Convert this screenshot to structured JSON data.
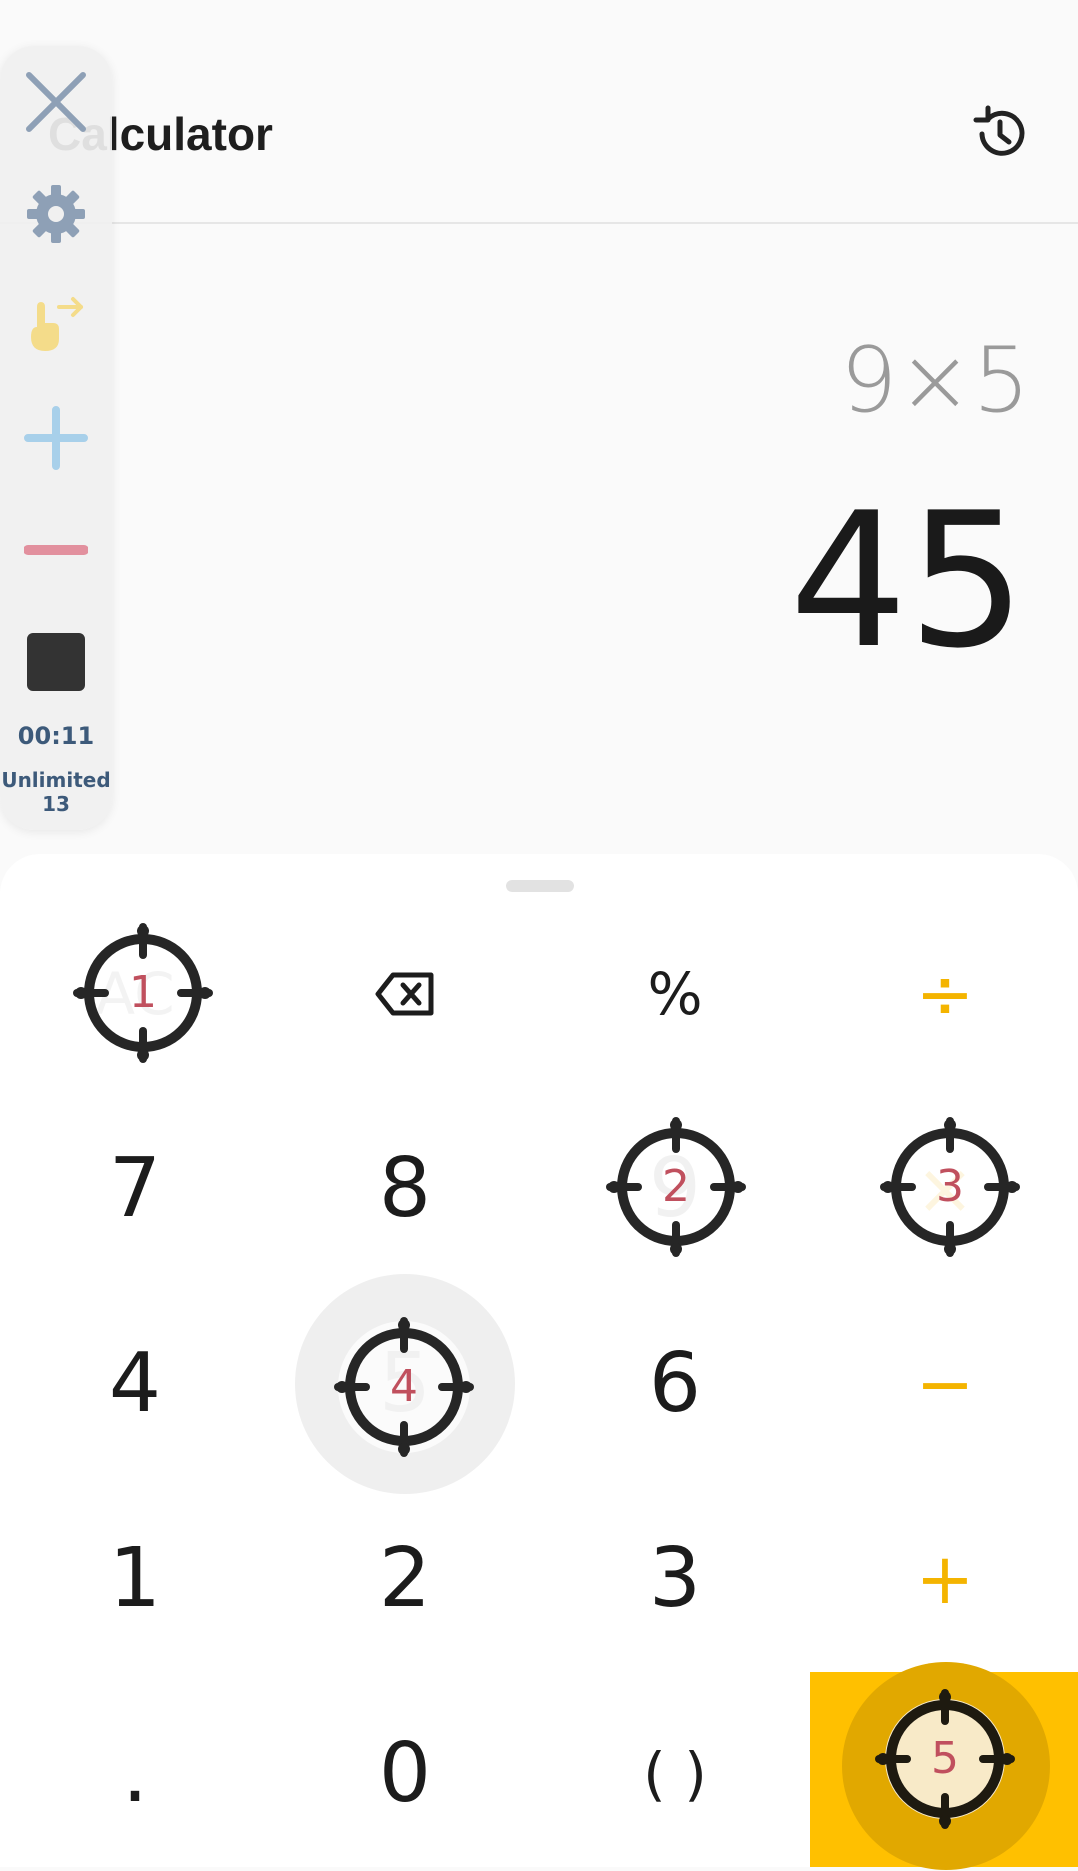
{
  "header": {
    "title": "Calculator",
    "history_icon": "history-icon"
  },
  "display": {
    "expression": "9×5",
    "result": "45"
  },
  "keypad": {
    "row1": [
      "AC",
      "backspace",
      "%",
      "÷"
    ],
    "row2": [
      "7",
      "8",
      "9",
      "×"
    ],
    "row3": [
      "4",
      "5",
      "6",
      "−"
    ],
    "row4": [
      "1",
      "2",
      "3",
      "+"
    ],
    "row5": [
      ".",
      "0",
      "( )",
      "="
    ],
    "accent_color": "#ffc000",
    "operator_color": "#f4b400"
  },
  "targets": [
    "1",
    "2",
    "3",
    "4",
    "5"
  ],
  "overlay": {
    "icons": [
      "close-icon",
      "gear-icon",
      "hand-swipe-icon",
      "plus-icon",
      "minus-icon",
      "stop-icon"
    ],
    "timer": "00:11",
    "plan_label": "Unlimited",
    "plan_count": "13"
  }
}
